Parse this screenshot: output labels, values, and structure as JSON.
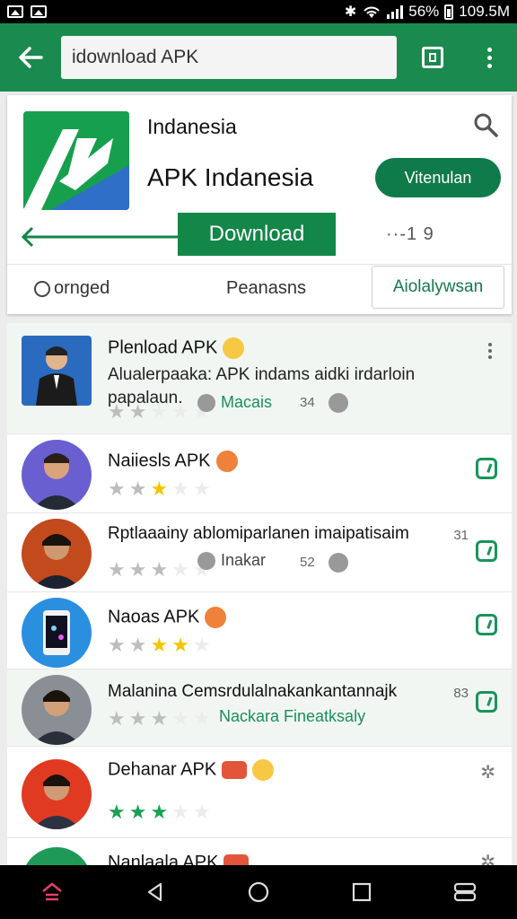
{
  "status_bar": {
    "battery_percent": "56%",
    "data_rate": "109.5M"
  },
  "toolbar": {
    "search_value": "idownload APK"
  },
  "app": {
    "developer": "Indanesia",
    "title": "APK Indanesia",
    "install_label": "Vitenulan",
    "download_label": "Download",
    "meta_number": "··-1 9",
    "chips": [
      "ornged",
      "Peanasns",
      "Aiolalywsan"
    ]
  },
  "list": {
    "items": [
      {
        "title": "Plenload APK",
        "desc_line1": "Alualerpaaka: APK indams aidki irdarloin",
        "desc_line2": "papalaun.",
        "tag": "Macais",
        "count": "34",
        "rating": 2,
        "rating_color": "off"
      },
      {
        "title": "Naiiesls APK",
        "rating": 3,
        "rating_color": "mixed"
      },
      {
        "title": "Rptlaaainy ablomiparlanen imaipatisaim",
        "tag": "Inakar",
        "count": "52",
        "side_count": "31",
        "rating": 3,
        "rating_color": "off"
      },
      {
        "title": "Naoas APK",
        "rating": 4,
        "rating_color": "mixed"
      },
      {
        "title": "Malanina Cemsrdulalnakankantannajk",
        "tag": "Nackara Fineatksaly",
        "side_count": "83",
        "rating": 3,
        "rating_color": "off"
      },
      {
        "title": "Dehanar APK",
        "rating": 3,
        "rating_color": "green"
      },
      {
        "title": "Nanlaala APK"
      }
    ]
  },
  "colors": {
    "primary_green": "#1a8a4e",
    "button_green": "#128748",
    "star_yellow": "#f5c400"
  },
  "icons": [
    "back-arrow-icon",
    "tabs-icon",
    "overflow-menu-icon",
    "search-icon",
    "home-icon",
    "back-nav-icon",
    "home-nav-icon",
    "recents-nav-icon",
    "switch-app-icon"
  ]
}
